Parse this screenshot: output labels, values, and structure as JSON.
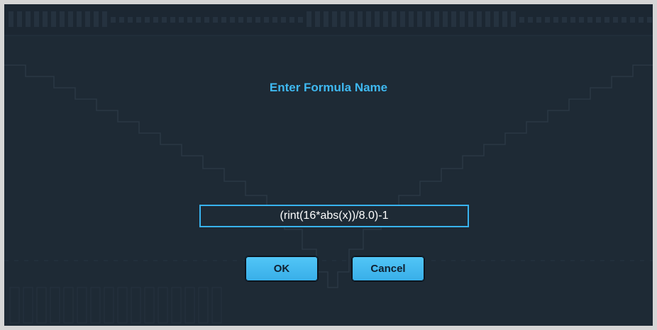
{
  "dialog": {
    "title": "Enter Formula Name",
    "formula_value": "(rint(16*abs(x))/8.0)-1",
    "ok_label": "OK",
    "cancel_label": "Cancel"
  },
  "colors": {
    "background": "#1e2a35",
    "accent": "#3fb8f0",
    "button_fill": "#45bcf2",
    "waveform_line": "#2c3a47"
  }
}
